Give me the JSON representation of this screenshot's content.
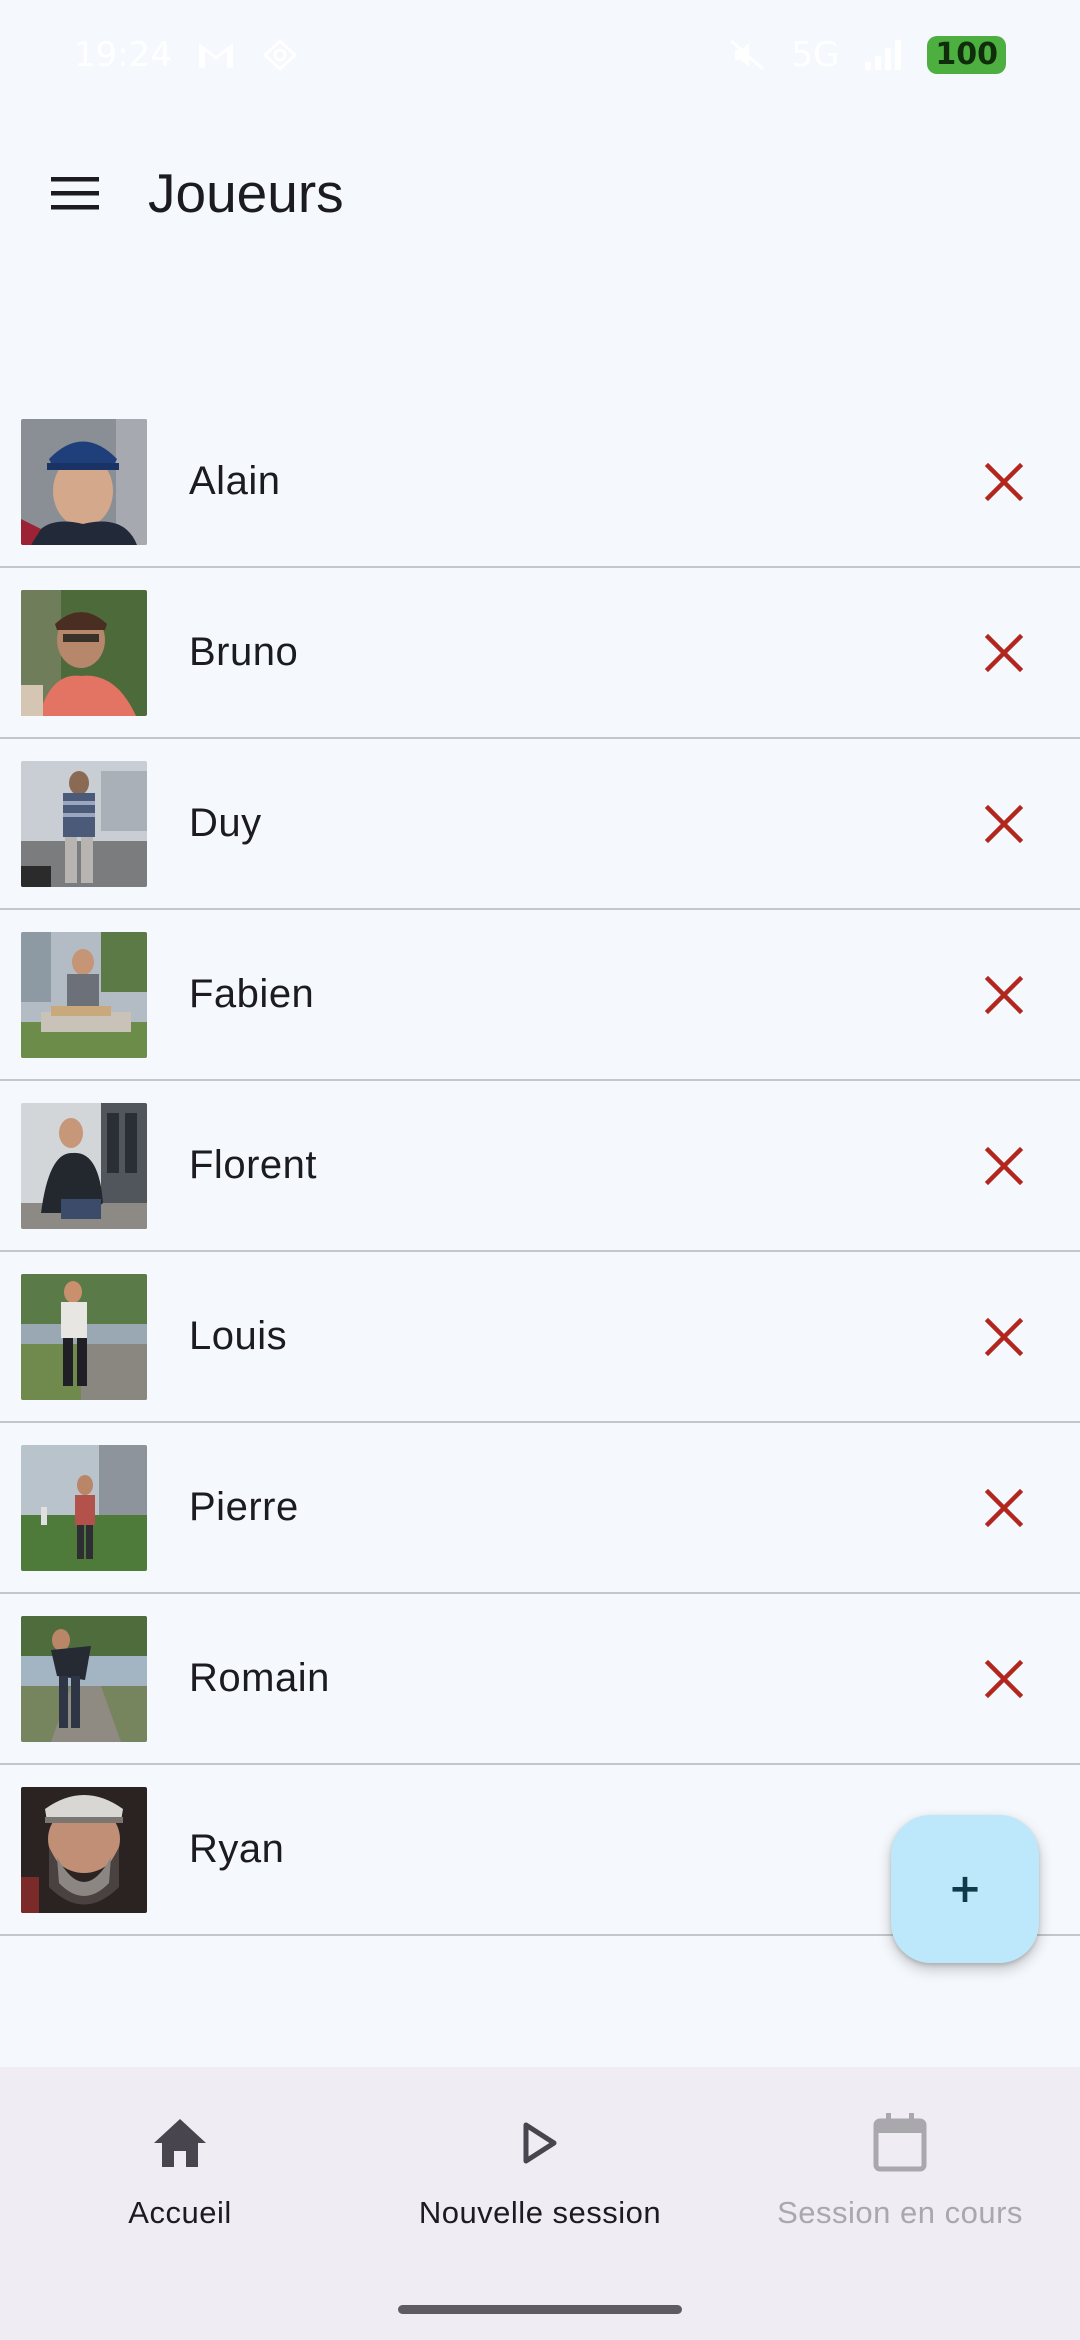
{
  "status_bar": {
    "time": "19:24",
    "network": "5G",
    "battery": "100"
  },
  "app_bar": {
    "menu_icon": "hamburger-menu-icon",
    "title": "Joueurs"
  },
  "players": [
    {
      "name": "Alain"
    },
    {
      "name": "Bruno"
    },
    {
      "name": "Duy"
    },
    {
      "name": "Fabien"
    },
    {
      "name": "Florent"
    },
    {
      "name": "Louis"
    },
    {
      "name": "Pierre"
    },
    {
      "name": "Romain"
    },
    {
      "name": "Ryan"
    }
  ],
  "fab": {
    "label": "+"
  },
  "bottom_nav": {
    "items": [
      {
        "label": "Accueil",
        "icon": "home-icon",
        "enabled": true
      },
      {
        "label": "Nouvelle session",
        "icon": "play-icon",
        "enabled": true
      },
      {
        "label": "Session en cours",
        "icon": "calendar-icon",
        "enabled": false
      }
    ]
  },
  "colors": {
    "background": "#f5f8fc",
    "delete": "#b3261e",
    "fab": "#bde8fb",
    "nav_background": "#efecf4",
    "battery": "#4caf3f"
  }
}
